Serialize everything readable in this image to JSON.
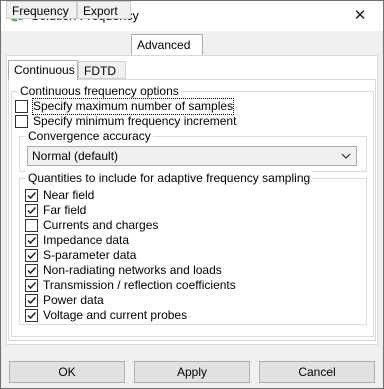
{
  "window": {
    "title": "Solution Frequency",
    "close_symbol": "✕"
  },
  "tabs": [
    "Frequency",
    "Export",
    "Advanced"
  ],
  "active_tab": "Advanced",
  "subtabs": [
    "Continuous",
    "FDTD"
  ],
  "active_subtab": "Continuous",
  "continuous_options": {
    "title": "Continuous frequency options",
    "checkboxes": [
      {
        "label": "Specify maximum number of samples",
        "checked": false
      },
      {
        "label": "Specify minimum frequency increment",
        "checked": false
      }
    ],
    "convergence": {
      "title": "Convergence accuracy",
      "selected": "Normal (default)"
    },
    "quantities": {
      "title": "Quantities to include for adaptive frequency sampling",
      "items": [
        {
          "label": "Near field",
          "checked": true
        },
        {
          "label": "Far field",
          "checked": true
        },
        {
          "label": "Currents and charges",
          "checked": false
        },
        {
          "label": "Impedance data",
          "checked": true
        },
        {
          "label": "S-parameter data",
          "checked": true
        },
        {
          "label": "Non-radiating networks and loads",
          "checked": true
        },
        {
          "label": "Transmission / reflection coefficients",
          "checked": true
        },
        {
          "label": "Power data",
          "checked": true
        },
        {
          "label": "Voltage and current probes",
          "checked": true
        }
      ]
    }
  },
  "buttons": {
    "ok": "OK",
    "apply": "Apply",
    "cancel": "Cancel"
  }
}
